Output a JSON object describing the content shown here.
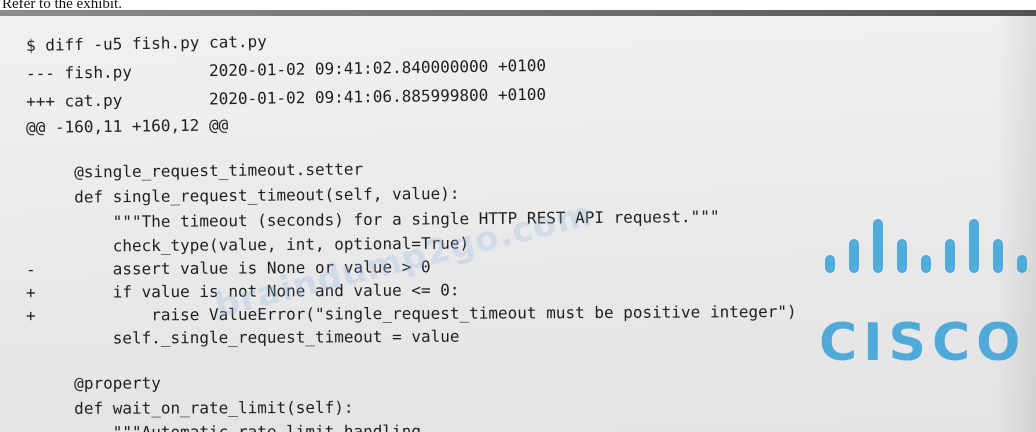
{
  "caption": "Refer to the exhibit.",
  "code_lines": [
    "$ diff -u5 fish.py cat.py",
    "--- fish.py        2020-01-02 09:41:02.840000000 +0100",
    "+++ cat.py         2020-01-02 09:41:06.885999800 +0100",
    "@@ -160,11 +160,12 @@",
    "     @single_request_timeout.setter",
    "     def single_request_timeout(self, value):",
    "         \"\"\"The timeout (seconds) for a single HTTP REST API request.\"\"\"",
    "         check_type(value, int, optional=True)",
    "-        assert value is None or value > 0",
    "+        if value is not None and value <= 0:",
    "+            raise ValueError(\"single_request_timeout must be positive integer\")",
    "         self._single_request_timeout = value",
    "     @property",
    "     def wait_on_rate_limit(self):",
    "         \"\"\"Automatic rate-limit handling."
  ],
  "logo": {
    "text": "CISCO",
    "color": "#3fa4d8"
  },
  "watermark": {
    "text": "braindump2go.com",
    "color": "#8fb8e6"
  }
}
